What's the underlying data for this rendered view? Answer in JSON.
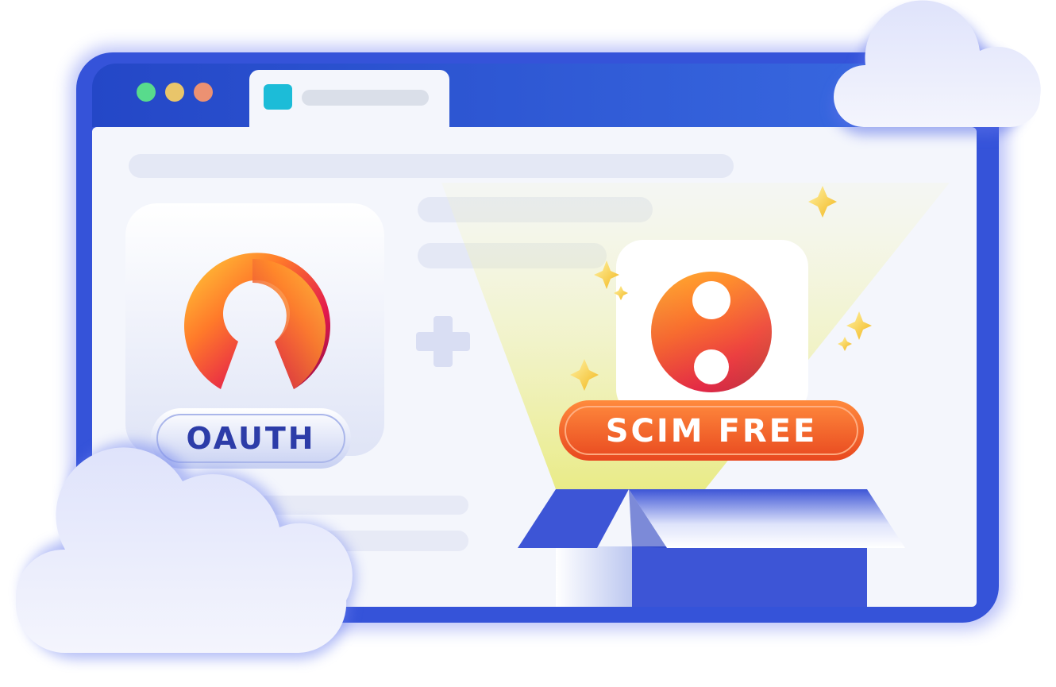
{
  "illustration": {
    "window_dots": [
      "#58db8c",
      "#e9c56a",
      "#ec9172"
    ],
    "tab_favicon_color": "#1cbcd8",
    "left_badge": {
      "label": "OAUTH",
      "icon": "keyhole-logo-icon"
    },
    "operator": {
      "icon": "plus-icon"
    },
    "right_badge": {
      "label": "SCIM FREE",
      "icon": "figure-eight-logo-icon"
    },
    "colors": {
      "frame": "#3553d9",
      "frame_glow": "#6f7ff0",
      "window_chrome": "#244ccf",
      "window_body": "#f4f6fc",
      "placeholder_bar": "#e4e8f5",
      "logo_gradient": [
        "#ffd23a",
        "#ff7a2a",
        "#e3194c",
        "#8a0f47"
      ],
      "scim_pill": "#f1602a",
      "oauth_text": "#2c3ca8",
      "box_blue": "#3d55d6",
      "sparkle": "#f6c832"
    }
  }
}
